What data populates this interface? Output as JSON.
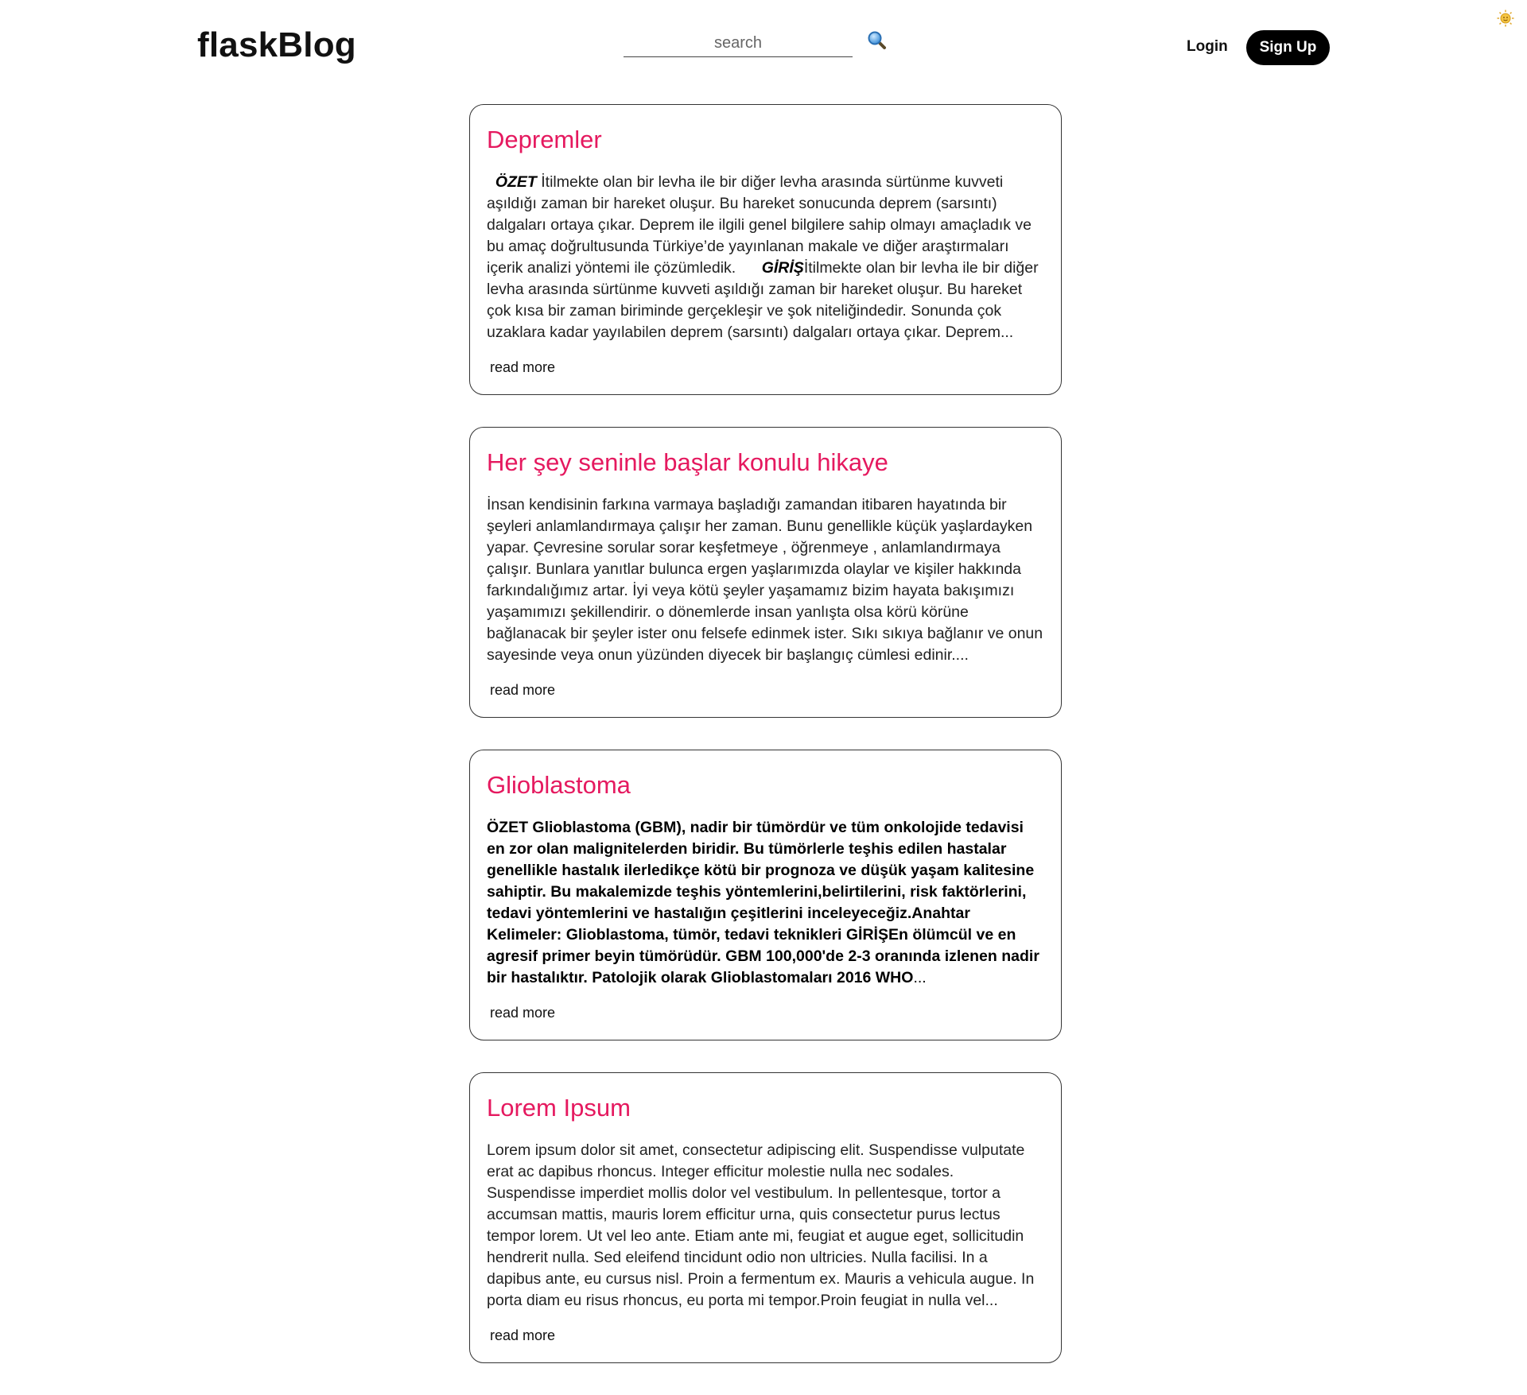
{
  "header": {
    "brand": "flaskBlog",
    "search_placeholder": "search",
    "search_icon": "magnifier-icon",
    "login_label": "Login",
    "signup_label": "Sign Up"
  },
  "corner_icon": "sun-icon",
  "colors": {
    "title": "#e5195f",
    "button_bg": "#000000",
    "card_border": "#333333"
  },
  "posts": [
    {
      "title": "Depremler",
      "segments": [
        {
          "text": "  ",
          "style": "normal"
        },
        {
          "text": "ÖZET",
          "style": "bold-italic"
        },
        {
          "text": " İtilmekte olan bir levha ile bir diğer levha arasında sürtünme kuvveti aşıldığı zaman bir hareket oluşur. Bu hareket sonucunda deprem (sarsıntı) dalgaları ortaya çıkar. Deprem ile ilgili genel bilgilere sahip olmayı amaçladık ve bu amaç doğrultusunda Türkiye’de yayınlanan makale ve diğer araştırmaları içerik analizi yöntemi ile çözümledik.      ",
          "style": "normal"
        },
        {
          "text": "GİRİŞ",
          "style": "bold-italic"
        },
        {
          "text": "İtilmekte olan bir levha ile bir diğer levha arasında sürtünme kuvveti aşıldığı zaman bir hareket oluşur. Bu hareket çok kısa bir zaman biriminde gerçekleşir ve şok niteliğindedir. Sonunda çok uzaklara kadar yayılabilen deprem (sarsıntı) dalgaları ortaya çıkar. Deprem...",
          "style": "normal"
        }
      ],
      "bold": false,
      "read_more": "read more"
    },
    {
      "title": "Her şey seninle başlar konulu hikaye",
      "segments": [
        {
          "text": "İnsan kendisinin farkına varmaya başladığı zamandan itibaren hayatında bir şeyleri anlamlandırmaya çalışır her zaman. Bunu genellikle küçük yaşlardayken yapar. Çevresine sorular sorar keşfetmeye , öğrenmeye , anlamlandırmaya çalışır. Bunlara yanıtlar bulunca ergen yaşlarımızda olaylar ve kişiler hakkında farkındalığımız artar. İyi veya kötü şeyler yaşamamız bizim hayata bakışımızı yaşamımızı şekillendirir. o dönemlerde insan yanlışta olsa körü körüne bağlanacak bir şeyler ister onu felsefe edinmek ister. Sıkı sıkıya bağlanır ve onun sayesinde veya onun yüzünden diyecek bir başlangıç cümlesi edinir....",
          "style": "normal"
        }
      ],
      "bold": false,
      "read_more": "read more"
    },
    {
      "title": "Glioblastoma",
      "segments": [
        {
          "text": "ÖZET  Glioblastoma (GBM), nadir bir tümördür ve tüm onkolojide tedavisi en zor olan malignitelerden biridir.  Bu tümörlerle teşhis edilen hastalar genellikle hastalık ilerledikçe kötü bir prognoza ve düşük yaşam kalitesine sahiptir. Bu makalemizde teşhis yöntemlerini,belirtilerini, risk faktörlerini, tedavi yöntemlerini ve hastalığın çeşitlerini inceleyeceğiz.Anahtar Kelimeler: Glioblastoma, tümör, tedavi teknikleri  GİRİŞEn ölümcül ve en agresif primer beyin tümörüdür. GBM 100,000'de 2-3 oranında izlenen nadir bir hastalıktır. Patolojik olarak Glioblastomaları 2016 WHO",
          "style": "bold"
        },
        {
          "text": "...",
          "style": "normal"
        }
      ],
      "bold": true,
      "read_more": "read more"
    },
    {
      "title": "Lorem Ipsum",
      "segments": [
        {
          "text": "Lorem ipsum dolor sit amet, consectetur adipiscing elit. Suspendisse vulputate erat ac dapibus rhoncus. Integer efficitur molestie nulla nec sodales. Suspendisse imperdiet mollis dolor vel vestibulum. In pellentesque, tortor a accumsan mattis, mauris lorem efficitur urna, quis consectetur purus lectus tempor lorem. Ut vel leo ante. Etiam ante mi, feugiat et augue eget, sollicitudin hendrerit nulla. Sed eleifend tincidunt odio non ultricies. Nulla facilisi. In a dapibus ante, eu cursus nisl. Proin a fermentum ex. Mauris a vehicula augue. In porta diam eu risus rhoncus, eu porta mi tempor.Proin feugiat in nulla vel...",
          "style": "normal"
        }
      ],
      "bold": false,
      "read_more": "read more"
    }
  ]
}
